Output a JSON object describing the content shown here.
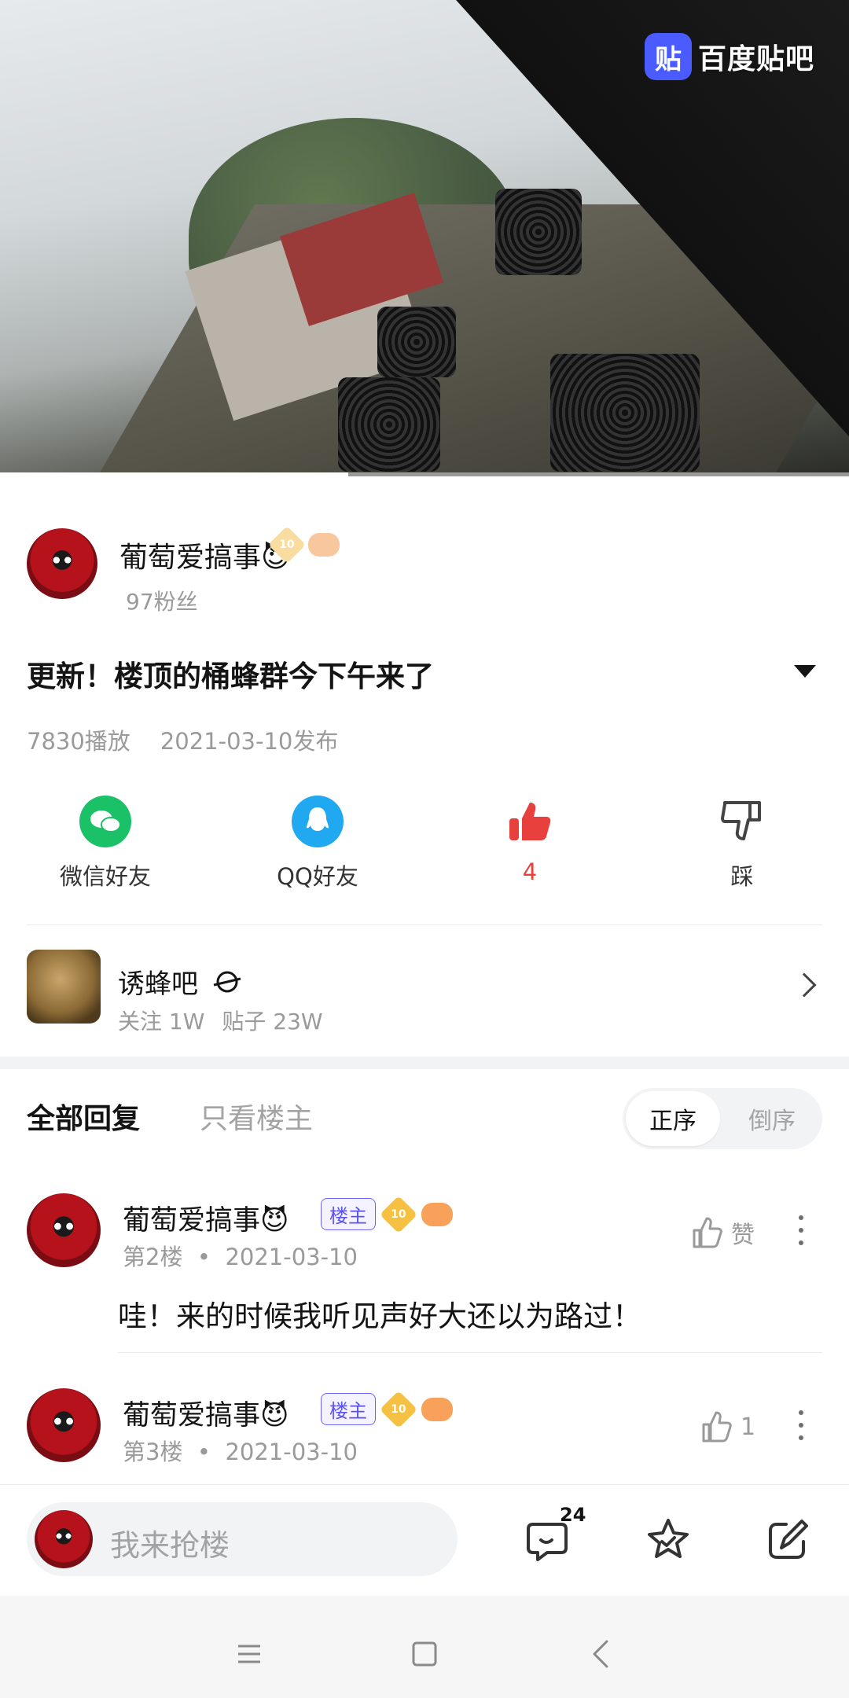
{
  "video": {
    "watermark": "百度贴吧",
    "watermark_icon_char": "贴",
    "progress": 0.41
  },
  "post": {
    "author": "葡萄爱搞事😈",
    "author_gem_level": "10",
    "fans": "97粉丝",
    "title": "更新！楼顶的桶蜂群今下午来了",
    "plays": "7830播放",
    "published": "2021-03-10发布"
  },
  "actions": {
    "wechat": "微信好友",
    "qq": "QQ好友",
    "like_count": "4",
    "dislike": "踩"
  },
  "forum": {
    "name": "诱蜂吧",
    "follows": "关注 1W",
    "posts": "贴子 23W"
  },
  "tabs": {
    "all": "全部回复",
    "owner_only": "只看楼主",
    "sort_asc": "正序",
    "sort_desc": "倒序"
  },
  "replies": [
    {
      "name": "葡萄爱搞事😈",
      "tag": "楼主",
      "gem": "10",
      "floor": "第2楼",
      "date": "2021-03-10",
      "like": "赞",
      "text": "哇！来的时候我听见声好大还以为路过！"
    },
    {
      "name": "葡萄爱搞事😈",
      "tag": "楼主",
      "gem": "10",
      "floor": "第3楼",
      "date": "2021-03-10",
      "like": "1"
    }
  ],
  "bottom": {
    "placeholder": "我来抢楼",
    "comment_count": "24"
  },
  "colors": {
    "wechat_green": "#1ac166",
    "qq_blue": "#20a8f0",
    "like_red": "#e8403c",
    "owner_tag": "#5b53f0",
    "baidu_blue": "#4a5cff"
  }
}
